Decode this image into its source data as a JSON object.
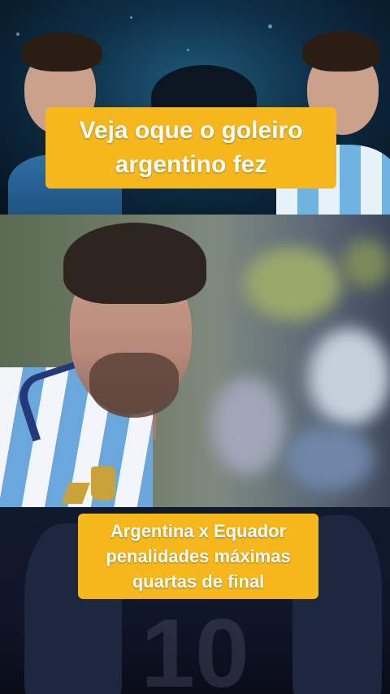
{
  "top_panel": {
    "caption": "Veja oque o goleiro argentino fez",
    "caption_lines": [
      "Veja oque o goleiro",
      "argentino fez"
    ]
  },
  "bottom_panel": {
    "caption_lines": [
      "Argentina x Equador",
      "penalidades máximas",
      "quartas de final"
    ]
  },
  "colors": {
    "caption_background": "#f6b81d",
    "caption_text": "#ffffff"
  }
}
